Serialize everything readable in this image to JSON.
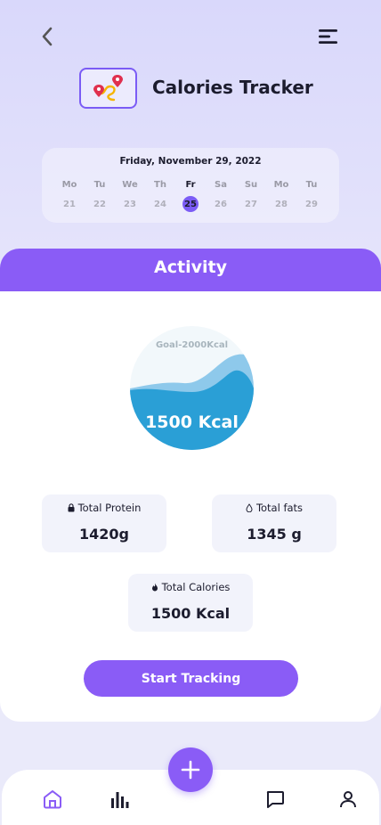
{
  "header": {
    "title": "Calories Tracker",
    "back_icon": "chevron-left-icon",
    "menu_icon": "menu-icon",
    "logo_icon": "route-pin-icon"
  },
  "calendar": {
    "date_label": "Friday, November 29, 2022",
    "days": [
      {
        "dow": "Mo",
        "num": "21"
      },
      {
        "dow": "Tu",
        "num": "22"
      },
      {
        "dow": "We",
        "num": "23"
      },
      {
        "dow": "Th",
        "num": "24"
      },
      {
        "dow": "Fr",
        "num": "25"
      },
      {
        "dow": "Sa",
        "num": "26"
      },
      {
        "dow": "Su",
        "num": "27"
      },
      {
        "dow": "Mo",
        "num": "28"
      },
      {
        "dow": "Tu",
        "num": "29"
      }
    ],
    "selected_num": "25"
  },
  "activity": {
    "title": "Activity",
    "goal_label": "Goal-2000Kcal",
    "value_label": "1500 Kcal"
  },
  "stats": {
    "protein": {
      "label": "Total Protein",
      "value": "1420g",
      "icon": "lock-icon"
    },
    "fats": {
      "label": "Total fats",
      "value": "1345 g",
      "icon": "droplet-icon"
    },
    "calories": {
      "label": "Total Calories",
      "value": "1500 Kcal",
      "icon": "flame-icon"
    }
  },
  "actions": {
    "start_label": "Start Tracking"
  },
  "nav": {
    "home_icon": "home-icon",
    "stats_icon": "bar-chart-icon",
    "add_icon": "plus-icon",
    "chat_icon": "chat-icon",
    "profile_icon": "user-icon"
  },
  "colors": {
    "accent": "#8a5cf6",
    "wave_dark": "#2a9fd6",
    "wave_light": "#7cc1e8"
  }
}
